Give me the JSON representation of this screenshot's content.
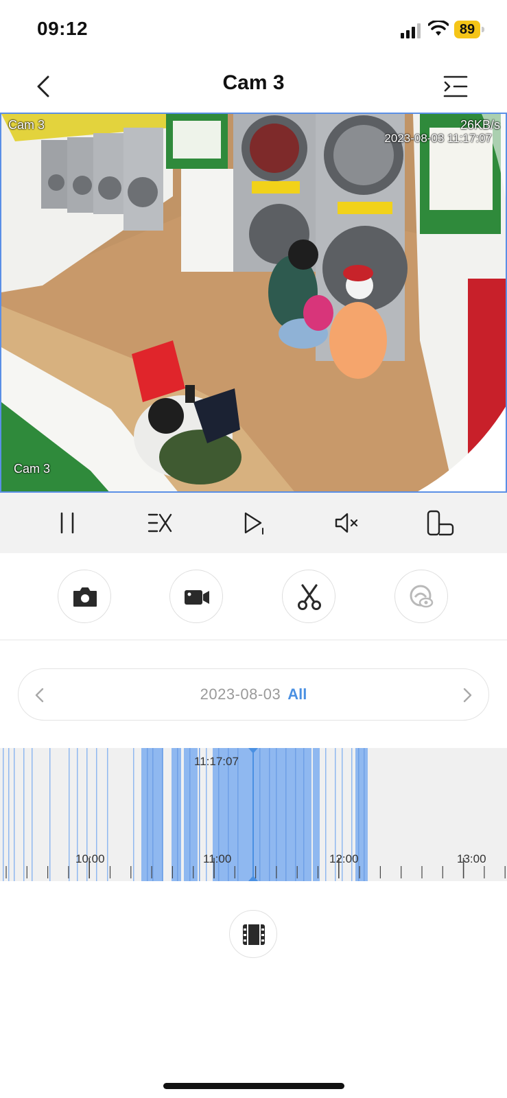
{
  "status_bar": {
    "time": "09:12",
    "battery": "89",
    "battery_color": "#f5c518",
    "icons": [
      "signal-icon",
      "wifi-icon",
      "battery-icon"
    ]
  },
  "nav": {
    "title": "Cam 3",
    "back_icon": "chevron-left-icon",
    "menu_icon": "list-menu-icon"
  },
  "video": {
    "camera_label_top": "Cam 3",
    "camera_label_bottom": "Cam 3",
    "bitrate": "26KB/s",
    "timestamp": "2023-08-03 11:17:07",
    "border_color": "#5a8fe6"
  },
  "controls": [
    {
      "name": "pause-button",
      "icon": "pause-icon"
    },
    {
      "name": "speed-button",
      "icon": "speed-x-icon"
    },
    {
      "name": "play-speed-button",
      "icon": "play-1x-icon"
    },
    {
      "name": "mute-button",
      "icon": "speaker-muted-icon"
    },
    {
      "name": "orientation-button",
      "icon": "rotate-phone-icon"
    }
  ],
  "actions": [
    {
      "name": "snapshot-button",
      "icon": "camera-icon"
    },
    {
      "name": "record-button",
      "icon": "video-camera-icon"
    },
    {
      "name": "clip-button",
      "icon": "scissors-icon"
    },
    {
      "name": "privacy-button",
      "icon": "eye-mask-icon",
      "disabled": true
    }
  ],
  "date_bar": {
    "date": "2023-08-03",
    "filter": "All",
    "accent": "#4a90e2"
  },
  "timeline": {
    "current_time": "11:17:07",
    "hour_labels": [
      "10:00",
      "11:00",
      "12:00",
      "13:00"
    ],
    "recording_color": "#8fb8f0",
    "cursor_color": "#4a90e2"
  },
  "film_button_icon": "film-strip-icon"
}
